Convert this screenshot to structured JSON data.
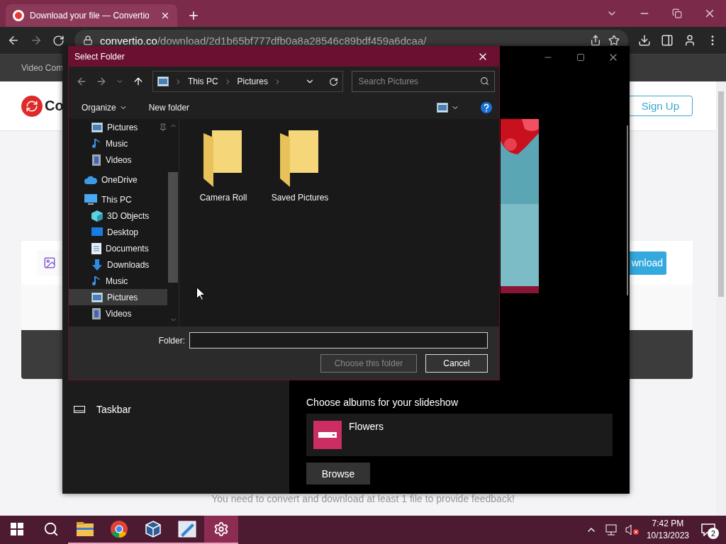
{
  "browser": {
    "tab": {
      "title": "Download your file — Convertio",
      "selected": true
    },
    "address": {
      "host": "convertio.co",
      "path": "/download/2d1b65bf777dfb0a8a28546c89bdf459a6dcaa/"
    },
    "bookmarks": [
      "Video Com"
    ],
    "page": {
      "logo_text": "Co",
      "signup": "Sign Up",
      "download_button": "wnload",
      "footer_text": "You need to convert and download at least 1 file to provide feedback!"
    }
  },
  "settings_window": {
    "nav_items": [
      {
        "label": "Taskbar",
        "selected": false
      }
    ],
    "section_title": "Choose albums for your slideshow",
    "albums": [
      {
        "name": "Flowers"
      }
    ],
    "browse": "Browse"
  },
  "dialog": {
    "title": "Select Folder",
    "breadcrumb": [
      "This PC",
      "Pictures"
    ],
    "search_placeholder": "Search Pictures",
    "toolbar": {
      "organize": "Organize",
      "new_folder": "New folder"
    },
    "quick_access": [
      {
        "label": "Pictures",
        "kind": "pictures",
        "pinned": true,
        "selected": false
      },
      {
        "label": "Music",
        "kind": "music",
        "pinned": false,
        "selected": false
      },
      {
        "label": "Videos",
        "kind": "videos",
        "pinned": false,
        "selected": false
      }
    ],
    "tree": [
      {
        "label": "OneDrive",
        "kind": "cloud",
        "selected": false
      },
      {
        "label": "This PC",
        "kind": "pc",
        "selected": false,
        "children": [
          {
            "label": "3D Objects",
            "kind": "cube",
            "selected": false
          },
          {
            "label": "Desktop",
            "kind": "desktop",
            "selected": false
          },
          {
            "label": "Documents",
            "kind": "documents",
            "selected": false
          },
          {
            "label": "Downloads",
            "kind": "downloads",
            "selected": false
          },
          {
            "label": "Music",
            "kind": "music",
            "selected": false
          },
          {
            "label": "Pictures",
            "kind": "pictures",
            "selected": true
          },
          {
            "label": "Videos",
            "kind": "videos",
            "selected": false
          }
        ]
      }
    ],
    "folders": [
      {
        "name": "Camera Roll"
      },
      {
        "name": "Saved Pictures"
      }
    ],
    "folder_label": "Folder:",
    "buttons": [
      {
        "label": "Choose this folder",
        "disabled": true
      },
      {
        "label": "Cancel",
        "disabled": false
      }
    ]
  },
  "taskbar": {
    "apps": [
      {
        "kind": "explorer",
        "active": false
      },
      {
        "kind": "chrome",
        "active": false
      },
      {
        "kind": "vbox",
        "active": false
      },
      {
        "kind": "snip",
        "active": false
      },
      {
        "kind": "settings",
        "active": true
      }
    ],
    "time": "7:42 PM",
    "date": "10/13/2023",
    "notifications": "2"
  }
}
